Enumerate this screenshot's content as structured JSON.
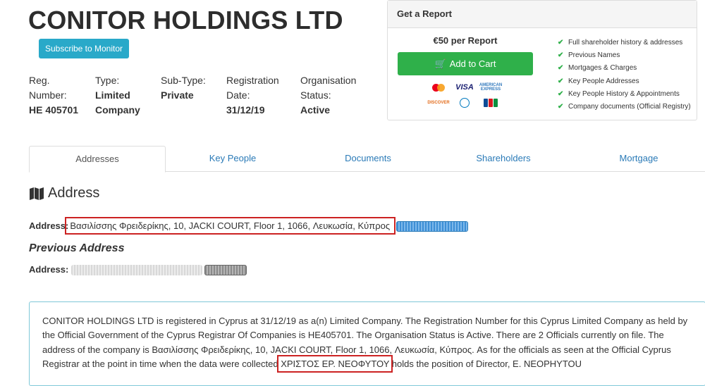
{
  "company": {
    "name": "CONITOR HOLDINGS LTD",
    "subscribe_label": "Subscribe to Monitor"
  },
  "info": {
    "reg_label": "Reg. Number:",
    "reg_value": "HE 405701",
    "type_label": "Type:",
    "type_value": "Limited Company",
    "subtype_label": "Sub-Type:",
    "subtype_value": "Private",
    "date_label": "Registration Date:",
    "date_value": "31/12/19",
    "status_label": "Organisation Status:",
    "status_value": "Active"
  },
  "report": {
    "heading": "Get a Report",
    "price": "€50 per Report",
    "cart_label": "Add to Cart",
    "payment_icons": {
      "visa": "VISA",
      "amex": "AMERICAN EXPRESS",
      "discover": "DISCOVER"
    },
    "features": [
      "Full shareholder history & addresses",
      "Previous Names",
      "Mortgages & Charges",
      "Key People Addresses",
      "Key People History & Appointments",
      "Company documents (Official Registry)"
    ]
  },
  "tabs": [
    {
      "label": "Addresses",
      "active": true
    },
    {
      "label": "Key People",
      "active": false
    },
    {
      "label": "Documents",
      "active": false
    },
    {
      "label": "Shareholders",
      "active": false
    },
    {
      "label": "Mortgage",
      "active": false
    }
  ],
  "address": {
    "heading": "Address",
    "label": "Address:",
    "value": "Βασιλίσσης Φρειδερίκης, 10, JACKI COURT, Floor 1, 1066, Λευκωσία, Κύπρος",
    "previous_heading": "Previous Address",
    "previous_label": "Address:"
  },
  "summary": {
    "text_before": "CONITOR HOLDINGS LTD is registered in Cyprus at 31/12/19 as a(n) Limited Company. The Registration Number for this Cyprus Limited Company as held by the Official Government of the Cyprus Registrar Of Companies is HE405701. The Organisation Status is Active. There are 2 Officials currently on file. The address of the company is Βασιλίσσης Φρειδερίκης, 10, JACKI COURT, Floor 1, 1066, Λευκωσία, Κύπρος. As for the officials as seen at the Official Cyprus Registrar at the point in time when the data were collected ",
    "highlight": "ΧΡΙΣΤΟΣ ΕΡ. ΝΕΟΦΥΤΟΥ",
    "text_after": " holds the position of Director, Ε. ΝΕΟΡΗΥΤΟU"
  },
  "colors": {
    "accent_teal": "#29a9c9",
    "cart_green": "#2fb04a",
    "link_blue": "#2a7ab7",
    "highlight_red": "#cc2222",
    "summary_border": "#7fc8d8"
  }
}
